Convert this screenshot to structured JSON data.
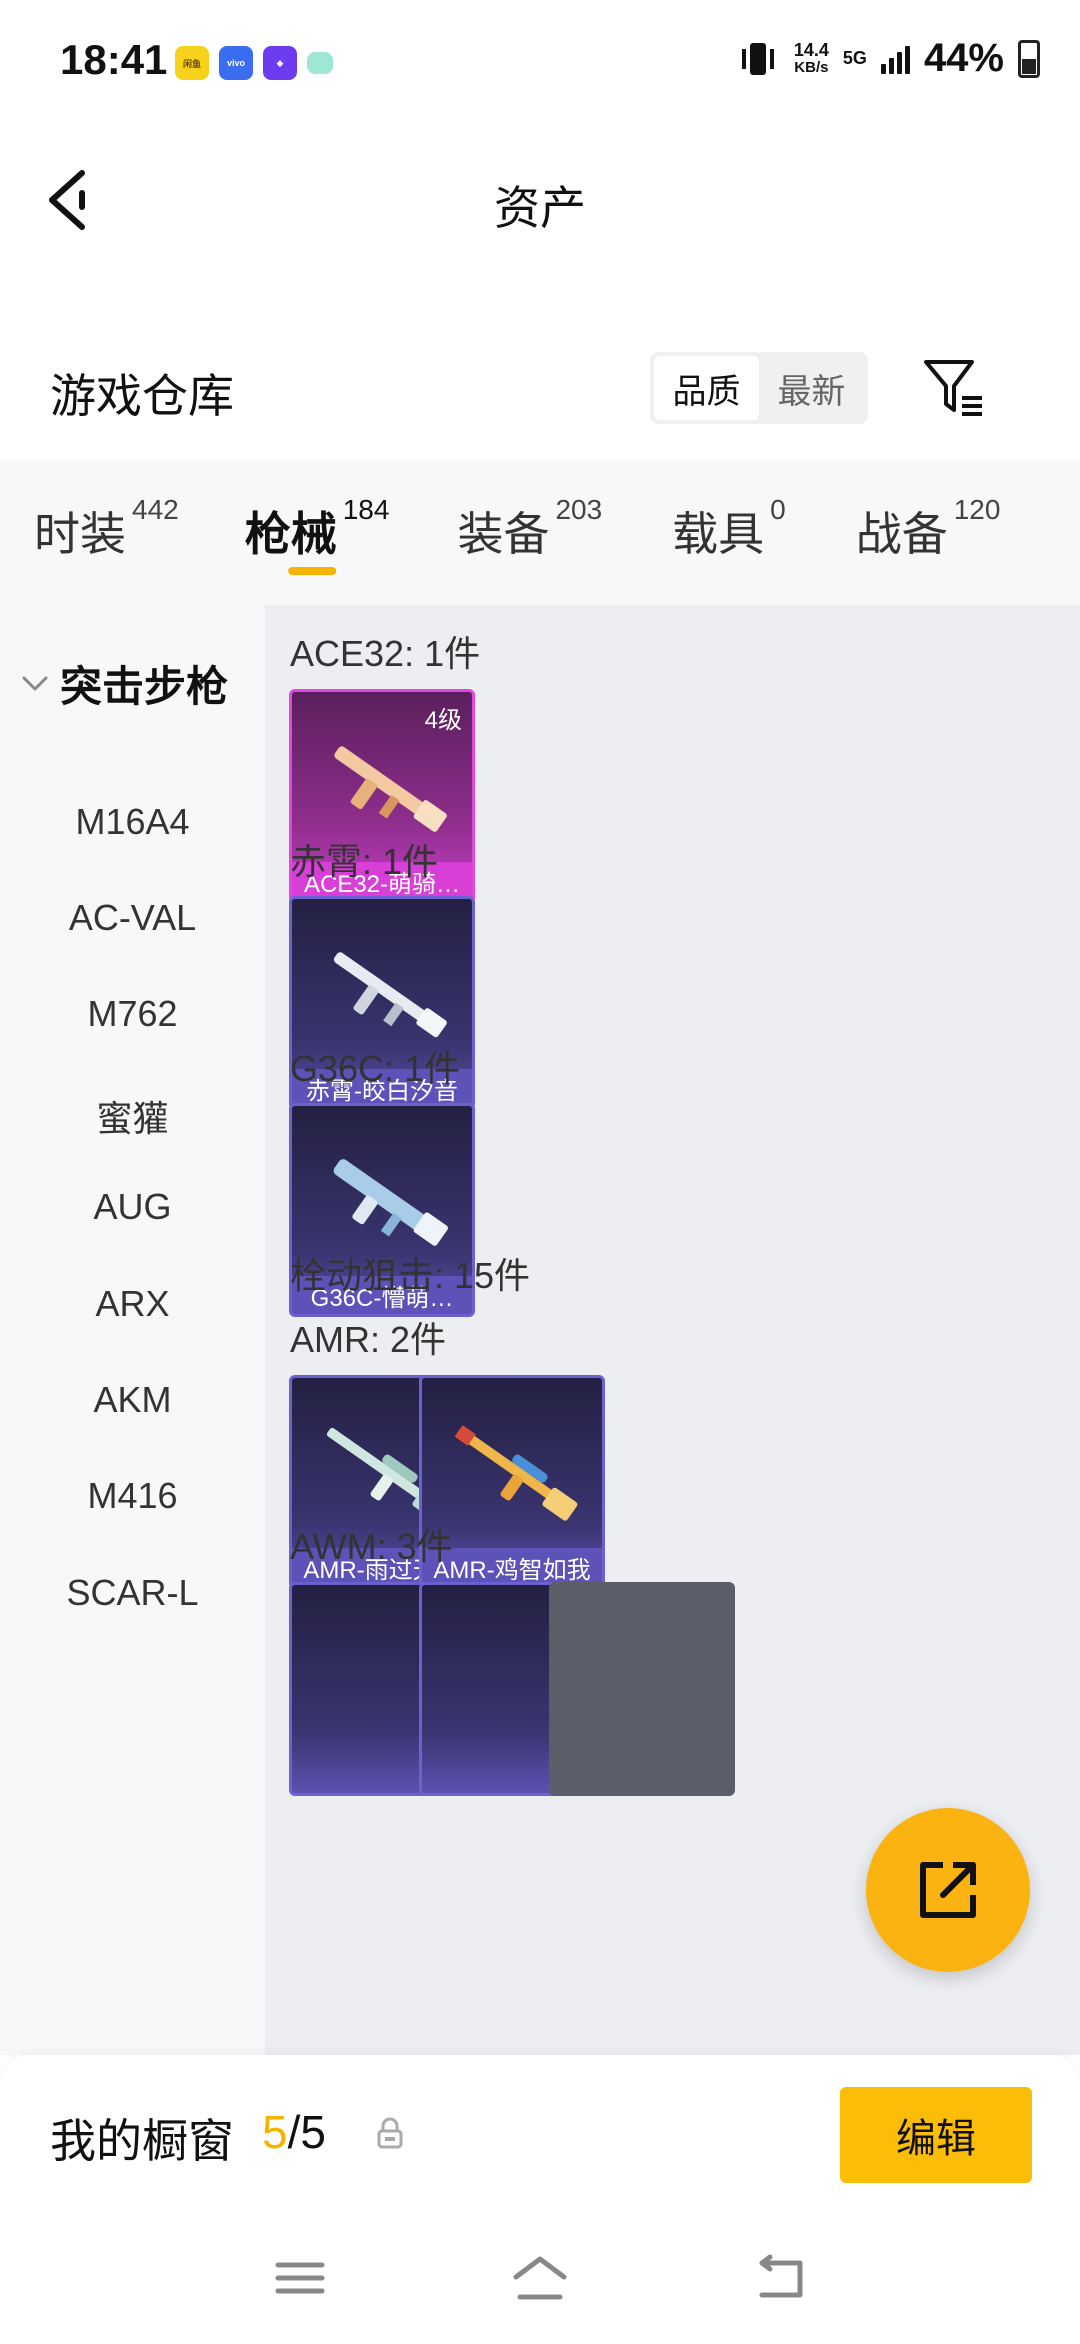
{
  "status_bar": {
    "time": "18:41",
    "apps": [
      {
        "name": "app-yellow-icon",
        "text": "闲鱼",
        "color": "#f7d21c"
      },
      {
        "name": "app-vivo-icon",
        "text": "vivo",
        "color": "#3a6df0"
      },
      {
        "name": "app-purple-icon",
        "text": "",
        "color": "#6b3cf0"
      },
      {
        "name": "app-teal-icon",
        "text": "",
        "color": "#9ee6d6"
      }
    ],
    "speed_value": "14.4",
    "speed_unit": "KB/s",
    "network": "5G",
    "battery": "44%"
  },
  "header": {
    "title": "资产"
  },
  "warehouse": {
    "title": "游戏仓库",
    "sort_options": [
      "品质",
      "最新"
    ],
    "active_sort": "品质"
  },
  "tabs": [
    {
      "label": "时装",
      "count": "442",
      "active": false
    },
    {
      "label": "枪械",
      "count": "184",
      "active": true
    },
    {
      "label": "装备",
      "count": "203",
      "active": false
    },
    {
      "label": "载具",
      "count": "0",
      "active": false
    },
    {
      "label": "战备",
      "count": "120",
      "active": false
    }
  ],
  "sidebar": {
    "header": "突击步枪",
    "items": [
      "M16A4",
      "AC-VAL",
      "M762",
      "蜜獾",
      "AUG",
      "ARX",
      "AKM",
      "M416",
      "SCAR-L"
    ]
  },
  "groups": [
    {
      "title": "ACE32: 1件",
      "items": [
        {
          "label": "ACE32-萌骑…",
          "level": "4级",
          "rarity": "pink"
        }
      ]
    },
    {
      "title": "赤霄: 1件",
      "items": [
        {
          "label": "赤霄-皎白汐音",
          "rarity": "purple"
        }
      ]
    },
    {
      "title": "G36C: 1件",
      "items": [
        {
          "label": "G36C-懵萌…",
          "rarity": "purple"
        }
      ]
    },
    {
      "title": "栓动狙击: 15件",
      "items": []
    },
    {
      "title": "AMR: 2件",
      "items": [
        {
          "label": "AMR-雨过天青",
          "rarity": "purple"
        },
        {
          "label": "AMR-鸡智如我",
          "rarity": "purple"
        }
      ]
    },
    {
      "title": "AWM: 3件",
      "items": []
    }
  ],
  "bottom": {
    "window_label": "我的橱窗",
    "window_current": "5",
    "window_total": "/5",
    "edit_label": "编辑"
  }
}
